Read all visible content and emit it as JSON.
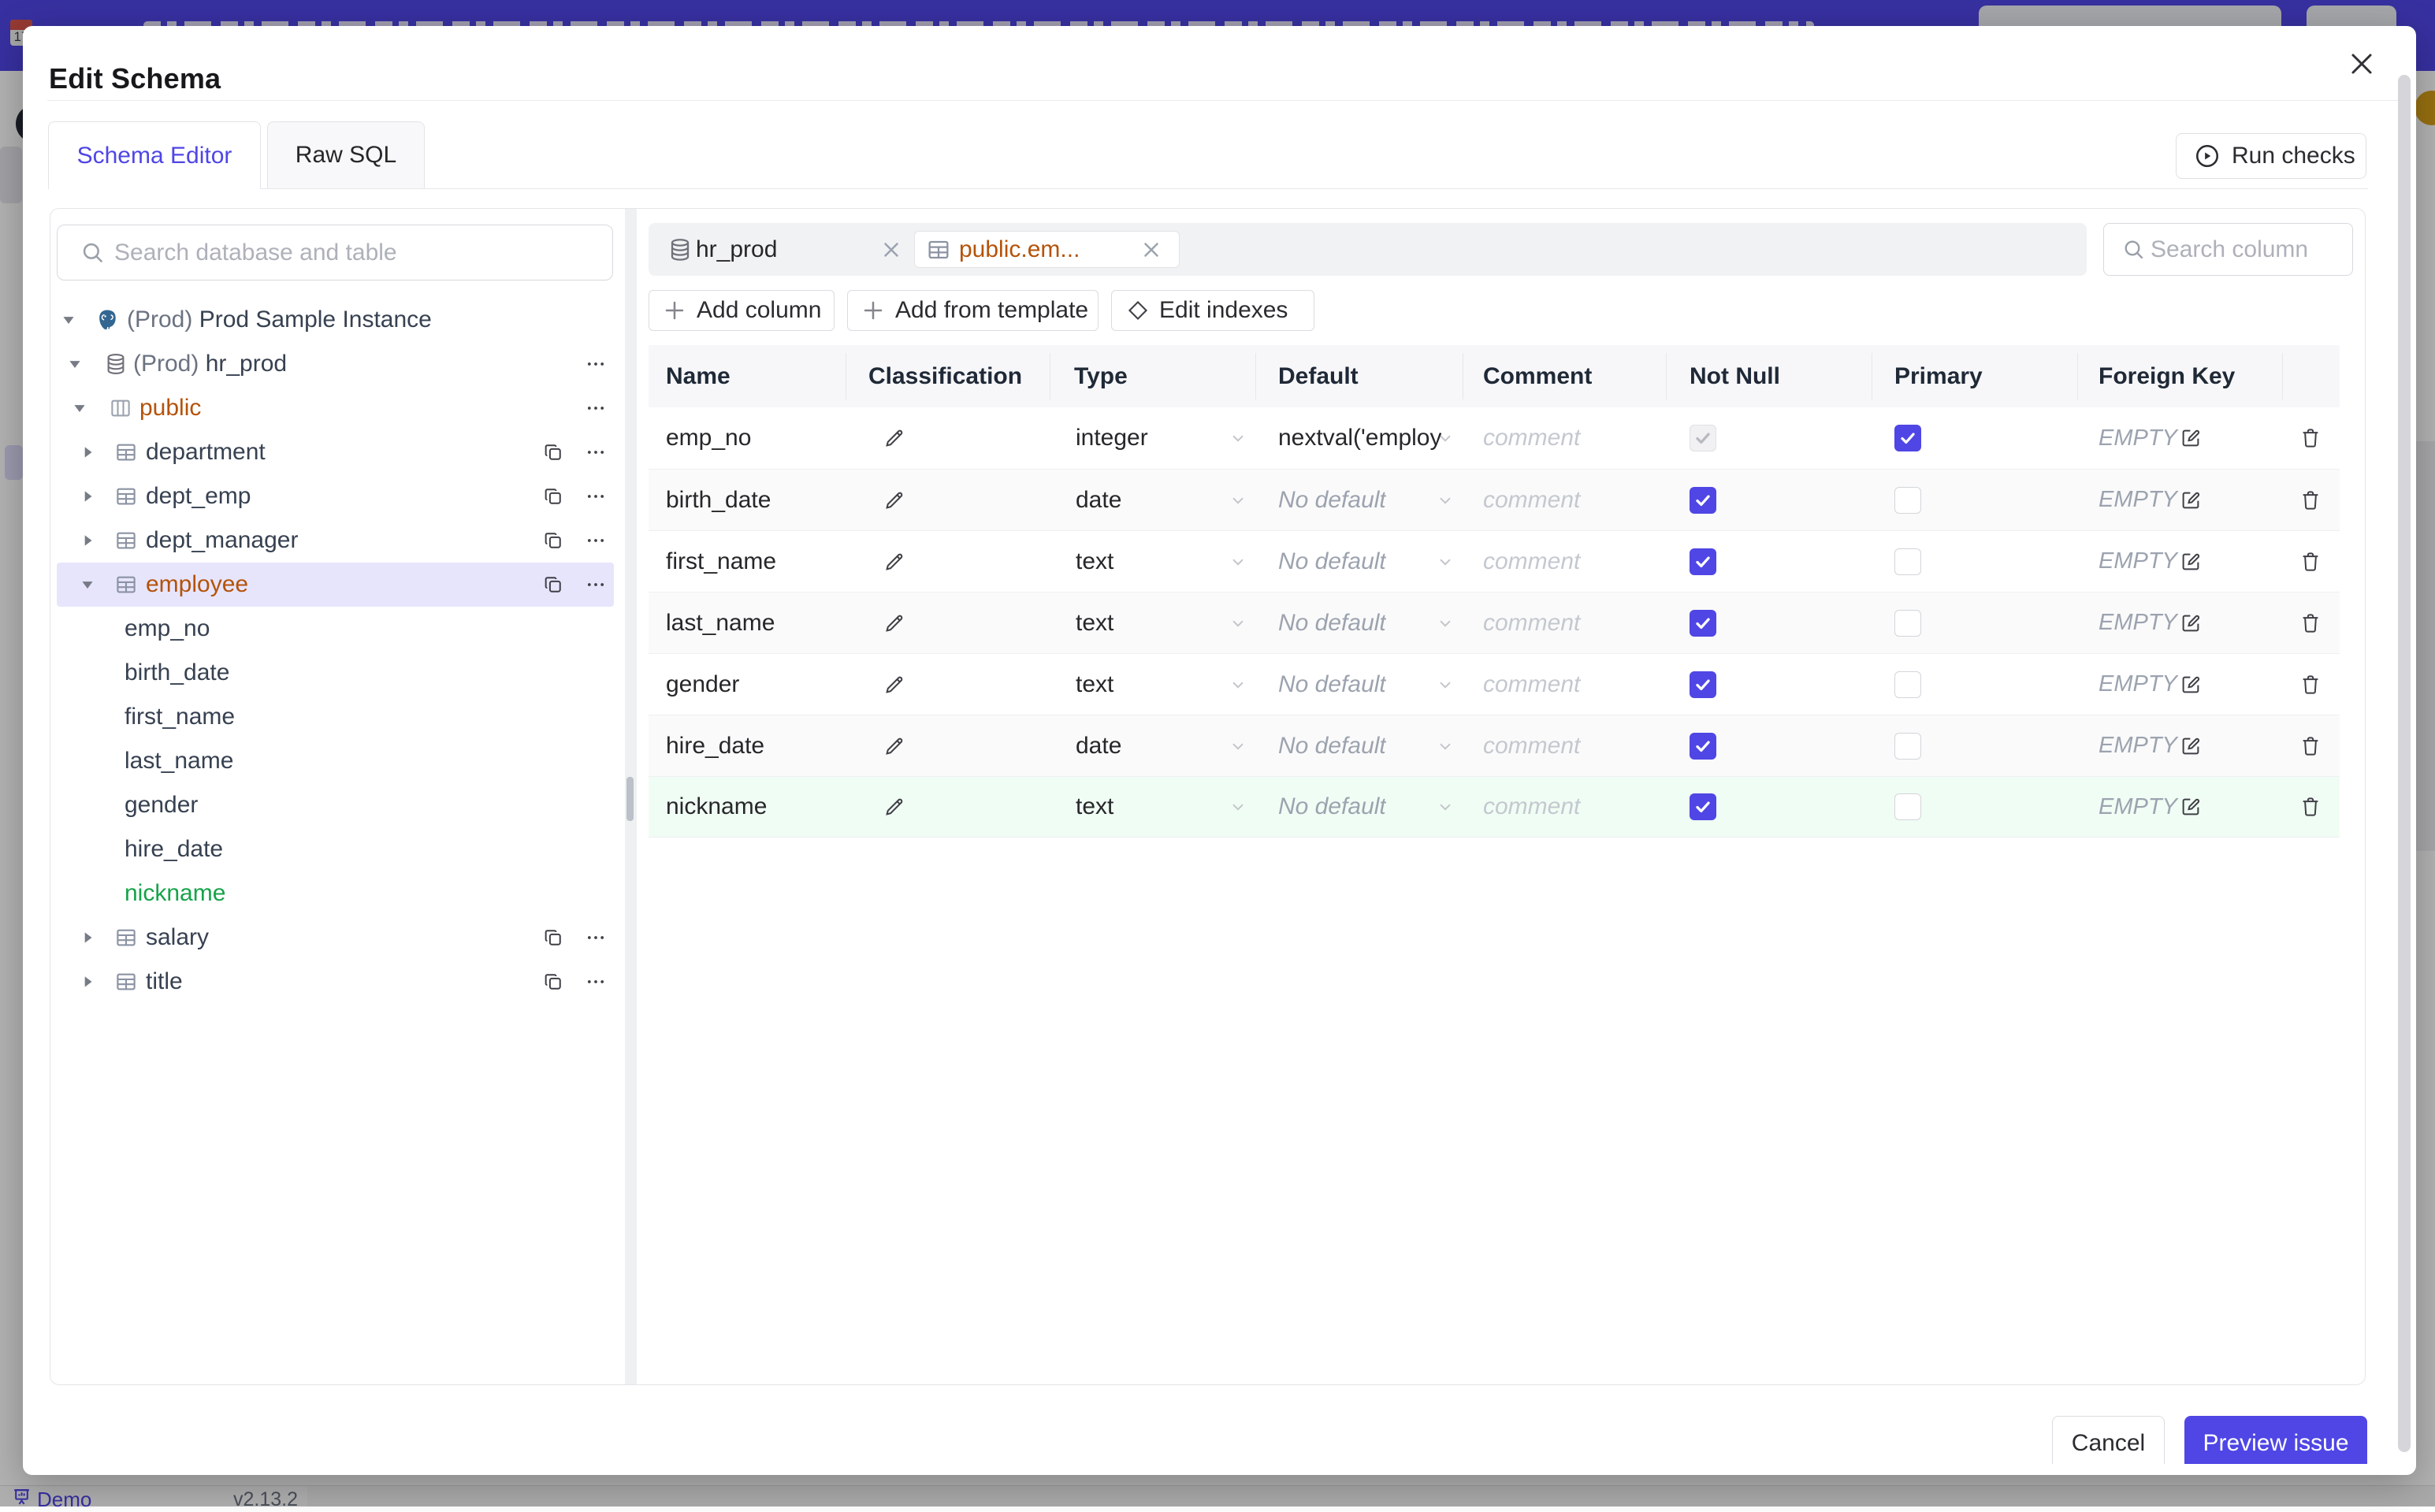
{
  "colors": {
    "accent_indigo": "#4f46e5",
    "selected_table_amber": "#b45309",
    "new_column_green": "#16a34a",
    "tree_selection_bg": "#e7e5fc",
    "new_row_bg": "#f0fdf4"
  },
  "background": {
    "footer": {
      "brand": "Demo",
      "version": "v2.13.2"
    }
  },
  "modal": {
    "title": "Edit Schema",
    "tabs": [
      {
        "label": "Schema Editor",
        "active": true
      },
      {
        "label": "Raw SQL",
        "active": false
      }
    ],
    "run_checks_label": "Run checks",
    "sidebar": {
      "search_placeholder": "Search database and table",
      "tree": [
        {
          "level": 1,
          "icon": "postgres",
          "caret": "down",
          "prefix": "(Prod) ",
          "label": "Prod Sample Instance",
          "actions": []
        },
        {
          "level": 2,
          "icon": "database",
          "caret": "down",
          "prefix": "(Prod) ",
          "label": "hr_prod",
          "actions": [
            "menu"
          ]
        },
        {
          "level": 3,
          "icon": "schema",
          "caret": "down",
          "label": "public",
          "color": "amber",
          "actions": [
            "menu"
          ]
        },
        {
          "level": 4,
          "icon": "table",
          "caret": "right",
          "label": "department",
          "actions": [
            "copy",
            "menu"
          ]
        },
        {
          "level": 4,
          "icon": "table",
          "caret": "right",
          "label": "dept_emp",
          "actions": [
            "copy",
            "menu"
          ]
        },
        {
          "level": 4,
          "icon": "table",
          "caret": "right",
          "label": "dept_manager",
          "actions": [
            "copy",
            "menu"
          ]
        },
        {
          "level": 4,
          "icon": "table",
          "caret": "down",
          "label": "employee",
          "color": "amber",
          "selected": true,
          "actions": [
            "copy",
            "menu"
          ]
        },
        {
          "level": 5,
          "label": "emp_no"
        },
        {
          "level": 5,
          "label": "birth_date"
        },
        {
          "level": 5,
          "label": "first_name"
        },
        {
          "level": 5,
          "label": "last_name"
        },
        {
          "level": 5,
          "label": "gender"
        },
        {
          "level": 5,
          "label": "hire_date"
        },
        {
          "level": 5,
          "label": "nickname",
          "color": "green"
        },
        {
          "level": 4,
          "icon": "table",
          "caret": "right",
          "label": "salary",
          "actions": [
            "copy",
            "menu"
          ]
        },
        {
          "level": 4,
          "icon": "table",
          "caret": "right",
          "label": "title",
          "actions": [
            "copy",
            "menu"
          ]
        }
      ]
    },
    "editor": {
      "chips": [
        {
          "icon": "database-icon",
          "label": "hr_prod"
        },
        {
          "icon": "table-icon",
          "label": "public.em...",
          "selected": true
        }
      ],
      "column_search_placeholder": "Search column",
      "toolbar": [
        {
          "icon": "plus",
          "label": "Add column"
        },
        {
          "icon": "plus",
          "label": "Add from template"
        },
        {
          "icon": "diamond",
          "label": "Edit indexes"
        }
      ],
      "table": {
        "columns": [
          "Name",
          "Classification",
          "Type",
          "Default",
          "Comment",
          "Not Null",
          "Primary",
          "Foreign Key"
        ],
        "foreign_key_value": "EMPTY",
        "comment_placeholder": "comment",
        "rows": [
          {
            "name": "emp_no",
            "type": "integer",
            "default": "nextval('employ",
            "default_muted": false,
            "not_null": "checked-disabled",
            "primary": "checked",
            "stripe": "white"
          },
          {
            "name": "birth_date",
            "type": "date",
            "default": "No default",
            "default_muted": true,
            "not_null": "checked",
            "primary": "unchecked",
            "stripe": "gray"
          },
          {
            "name": "first_name",
            "type": "text",
            "default": "No default",
            "default_muted": true,
            "not_null": "checked",
            "primary": "unchecked",
            "stripe": "white"
          },
          {
            "name": "last_name",
            "type": "text",
            "default": "No default",
            "default_muted": true,
            "not_null": "checked",
            "primary": "unchecked",
            "stripe": "gray"
          },
          {
            "name": "gender",
            "type": "text",
            "default": "No default",
            "default_muted": true,
            "not_null": "checked",
            "primary": "unchecked",
            "stripe": "white"
          },
          {
            "name": "hire_date",
            "type": "date",
            "default": "No default",
            "default_muted": true,
            "not_null": "checked",
            "primary": "unchecked",
            "stripe": "gray"
          },
          {
            "name": "nickname",
            "type": "text",
            "default": "No default",
            "default_muted": true,
            "not_null": "checked",
            "primary": "unchecked",
            "stripe": "green"
          }
        ]
      }
    },
    "footer": {
      "cancel": "Cancel",
      "primary": "Preview issue"
    }
  }
}
